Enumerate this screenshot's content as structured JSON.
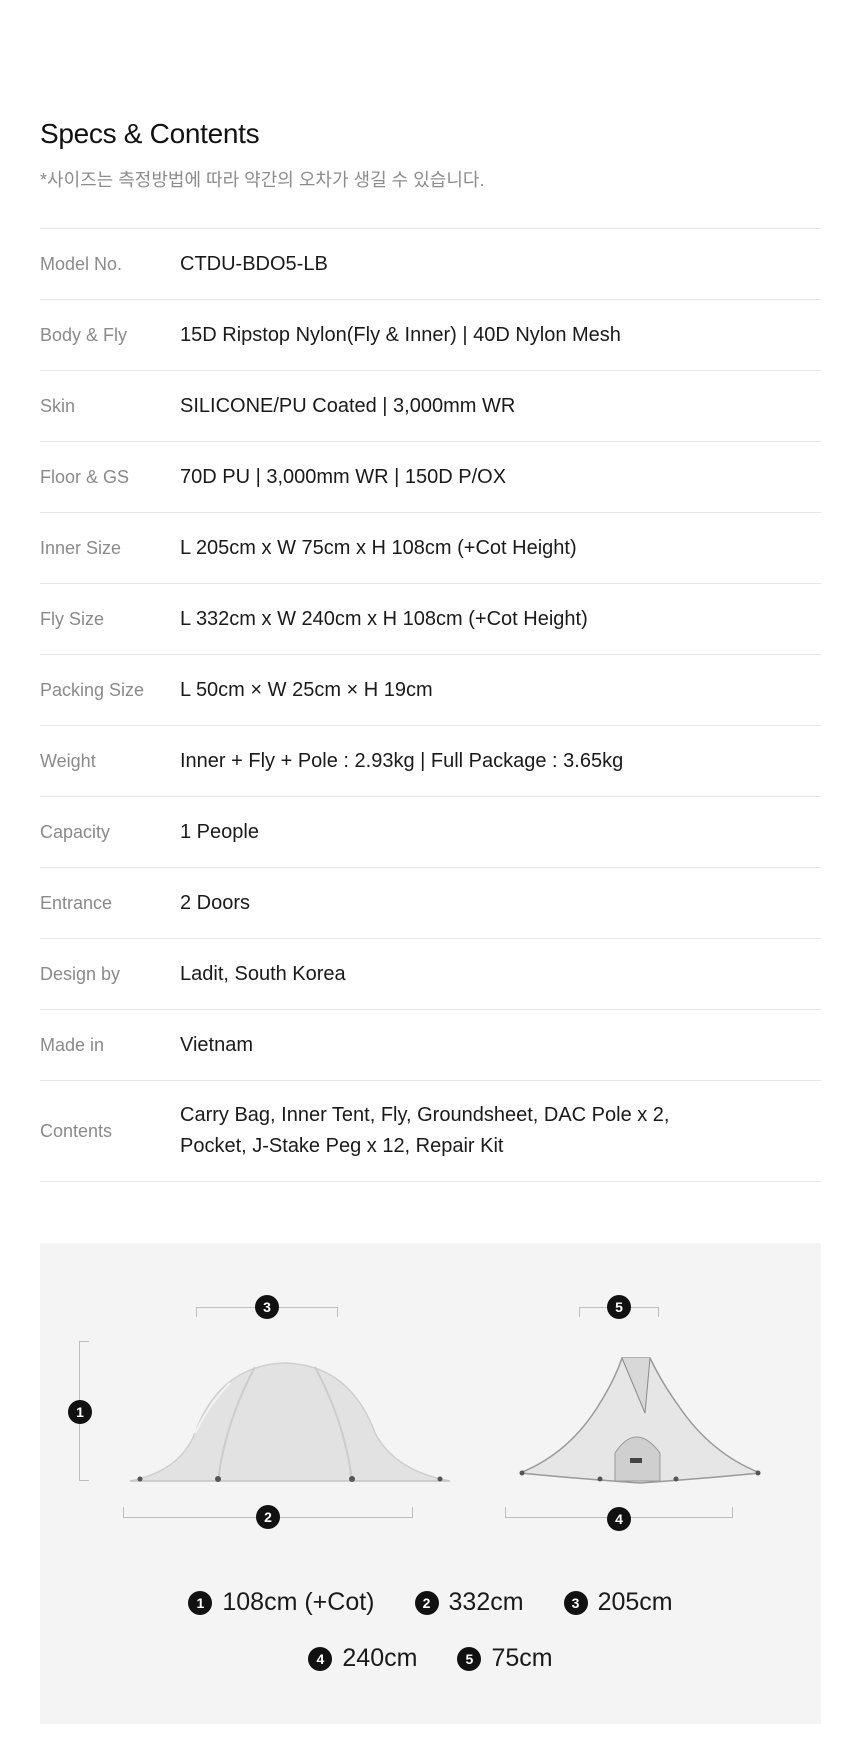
{
  "header": {
    "title": "Specs & Contents",
    "note": "*사이즈는 측정방법에 따라 약간의 오차가 생길 수 있습니다."
  },
  "specs": [
    {
      "label": "Model No.",
      "value": "CTDU-BDO5-LB"
    },
    {
      "label": "Body & Fly",
      "value": "15D Ripstop Nylon(Fly & Inner) | 40D Nylon Mesh"
    },
    {
      "label": "Skin",
      "value": "SILICONE/PU Coated | 3,000mm WR"
    },
    {
      "label": "Floor & GS",
      "value": "70D PU | 3,000mm WR | 150D P/OX"
    },
    {
      "label": "Inner Size",
      "value": "L 205cm x W 75cm x H 108cm (+Cot Height)"
    },
    {
      "label": "Fly Size",
      "value": "L 332cm x W 240cm x H 108cm (+Cot Height)"
    },
    {
      "label": "Packing Size",
      "value": "L 50cm × W 25cm × H 19cm"
    },
    {
      "label": "Weight",
      "value": "Inner + Fly + Pole : 2.93kg | Full Package : 3.65kg"
    },
    {
      "label": "Capacity",
      "value": "1 People"
    },
    {
      "label": "Entrance",
      "value": "2 Doors"
    },
    {
      "label": "Design by",
      "value": "Ladit, South Korea"
    },
    {
      "label": "Made in",
      "value": "Vietnam"
    },
    {
      "label": "Contents",
      "value": "Carry Bag, Inner Tent, Fly, Groundsheet, DAC Pole x 2,\nPocket, J-Stake Peg x 12, Repair Kit"
    }
  ],
  "diagram": {
    "markers": [
      "1",
      "2",
      "3",
      "4",
      "5"
    ],
    "legend": [
      {
        "num": "1",
        "text": "108cm (+Cot)"
      },
      {
        "num": "2",
        "text": "332cm"
      },
      {
        "num": "3",
        "text": "205cm"
      },
      {
        "num": "4",
        "text": "240cm"
      },
      {
        "num": "5",
        "text": "75cm"
      }
    ]
  },
  "colors": {
    "badge": "#111111",
    "panel": "#f4f4f4",
    "divider": "#e6e6e6",
    "label": "#8a8a8a"
  }
}
